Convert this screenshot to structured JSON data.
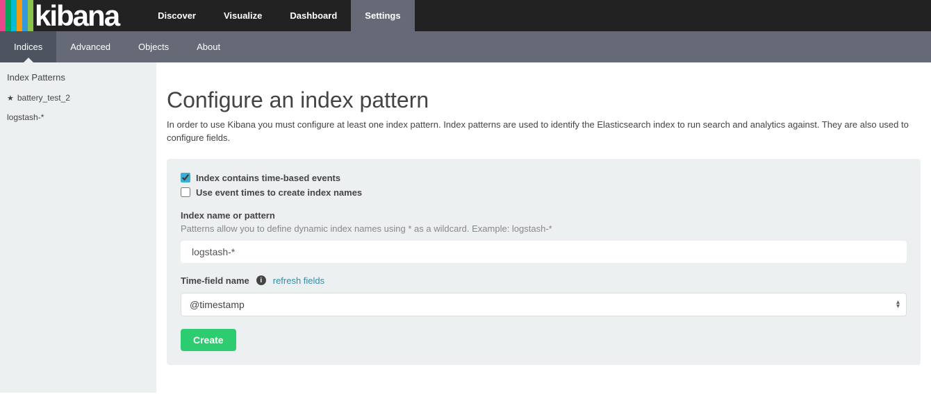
{
  "logo": {
    "text": "kibana",
    "bar_colors": [
      "#e8478b",
      "#00a65a",
      "#00bcd4",
      "#f39c12",
      "#3498db",
      "#8bc34a"
    ]
  },
  "topnav": {
    "items": [
      {
        "label": "Discover"
      },
      {
        "label": "Visualize"
      },
      {
        "label": "Dashboard"
      },
      {
        "label": "Settings"
      }
    ],
    "active_index": 3
  },
  "subnav": {
    "items": [
      {
        "label": "Indices"
      },
      {
        "label": "Advanced"
      },
      {
        "label": "Objects"
      },
      {
        "label": "About"
      }
    ],
    "active_index": 0
  },
  "sidebar": {
    "header": "Index Patterns",
    "items": [
      {
        "label": "battery_test_2",
        "starred": true
      },
      {
        "label": "logstash-*",
        "starred": false
      }
    ]
  },
  "page": {
    "title": "Configure an index pattern",
    "description": "In order to use Kibana you must configure at least one index pattern. Index patterns are used to identify the Elasticsearch index to run search and analytics against. They are also used to configure fields."
  },
  "form": {
    "timebased_label": "Index contains time-based events",
    "timebased_checked": true,
    "eventtimes_label": "Use event times to create index names",
    "eventtimes_checked": false,
    "indexname_label": "Index name or pattern",
    "indexname_hint": "Patterns allow you to define dynamic index names using * as a wildcard. Example: logstash-*",
    "indexname_value": "logstash-*",
    "timefield_label": "Time-field name",
    "refresh_link": "refresh fields",
    "timefield_value": "@timestamp",
    "create_label": "Create"
  }
}
